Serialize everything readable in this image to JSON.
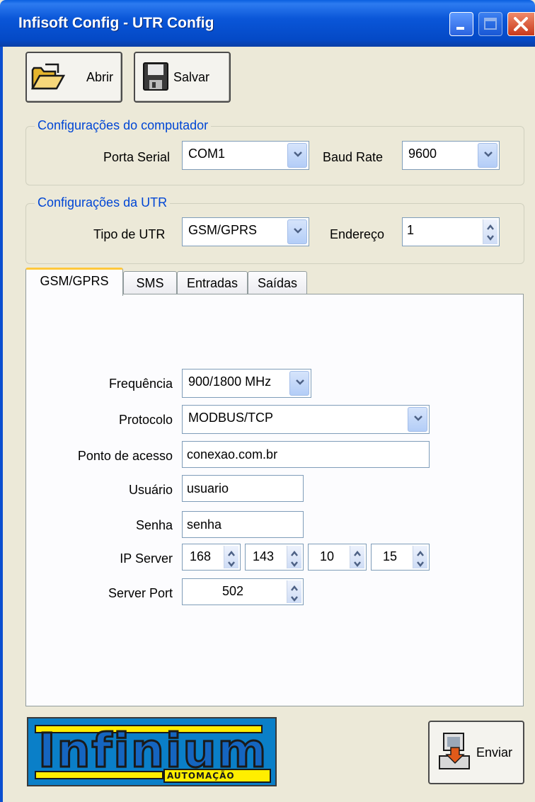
{
  "window": {
    "title": "Infisoft Config - UTR Config"
  },
  "toolbar": {
    "open_label": "Abrir",
    "save_label": "Salvar"
  },
  "computer_group": {
    "title": "Configurações do computador",
    "serial_port_label": "Porta Serial",
    "serial_port_value": "COM1",
    "baud_rate_label": "Baud Rate",
    "baud_rate_value": "9600"
  },
  "utr_group": {
    "title": "Configurações da UTR",
    "type_label": "Tipo de UTR",
    "type_value": "GSM/GPRS",
    "address_label": "Endereço",
    "address_value": "1"
  },
  "tabs": [
    {
      "label": "GSM/GPRS",
      "active": true
    },
    {
      "label": "SMS",
      "active": false
    },
    {
      "label": "Entradas",
      "active": false
    },
    {
      "label": "Saídas",
      "active": false
    }
  ],
  "gsm": {
    "frequency_label": "Frequência",
    "frequency_value": "900/1800 MHz",
    "protocol_label": "Protocolo",
    "protocol_value": "MODBUS/TCP",
    "apn_label": "Ponto de acesso",
    "apn_value": "conexao.com.br",
    "user_label": "Usuário",
    "user_value": "usuario",
    "password_label": "Senha",
    "password_value": "senha",
    "ip_label": "IP Server",
    "ip_octets": [
      "168",
      "143",
      "10",
      "15"
    ],
    "port_label": "Server Port",
    "port_value": "502"
  },
  "logo": {
    "brand": "Infinium",
    "tagline": "AUTOMAÇÃO"
  },
  "send_button": {
    "label": "Enviar"
  },
  "colors": {
    "titlebar": "#0a56d8",
    "group_title": "#0046d5",
    "tab_accent": "#ffc83c",
    "logo_bg": "#0a7fc8",
    "logo_yellow": "#ffee00"
  }
}
